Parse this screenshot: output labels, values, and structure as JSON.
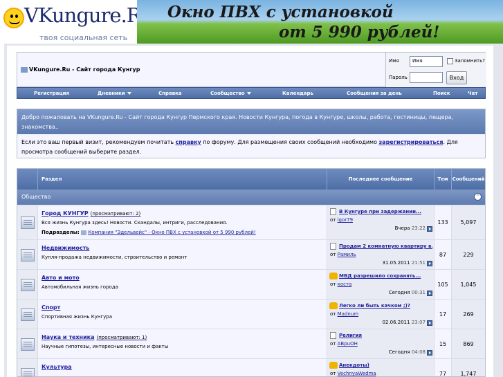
{
  "logo": {
    "brand": "VKungure.Ru",
    "tagline": "твоя социальная сеть"
  },
  "banner": {
    "line1": "Окно ПВХ с установкой",
    "line2": "от 5 990 рублей!"
  },
  "site": {
    "title": "VKungure.Ru - Сайт города Кунгур"
  },
  "login": {
    "username_label": "Имя",
    "username_value": "Имя",
    "remember_label": "Запомнить?",
    "password_label": "Пароль",
    "submit_label": "Вход"
  },
  "nav": {
    "items": [
      "Регистрация",
      "Дневники",
      "Справка",
      "Сообщество",
      "Календарь",
      "Сообщения за день",
      "Поиск",
      "Чат"
    ]
  },
  "welcome": {
    "title": "Добро пожаловать на VKungure.Ru - Сайт города Кунгур Пермского края. Новости Кунгура, погода в Кунгуре, школы, работа, гостиницы, пещера, знакомства..",
    "text_a": "Если это ваш первый визит, рекомендуем почитать ",
    "link_help": "справку",
    "text_b": " по форуму. Для размещения своих сообщений необходимо ",
    "link_register": "зарегистрироваться",
    "text_c": ". Для просмотра сообщений выберите раздел."
  },
  "table": {
    "headers": {
      "section": "Раздел",
      "last_post": "Последнее сообщение",
      "threads": "Тем",
      "posts": "Сообщений"
    },
    "category": "Общество",
    "subforums_label": "Подразделы:",
    "by_prefix": "от",
    "rows": [
      {
        "name": "Город КУНГУР",
        "viewing": "(просматривают: 2)",
        "desc": "Вся жизнь Кунгура здесь! Новости. Скандалы, интриги, расследования.",
        "subforum": "Компания \"Эдельвейс\" - Окно ПВХ с установкой от 5 990 рублей!",
        "last_title": "В Кунгуре при задержании...",
        "last_by": "igor79",
        "last_date": "Вчера",
        "last_time": "23:22",
        "icon": "post",
        "threads": "133",
        "posts": "5,097"
      },
      {
        "name": "Недвижимость",
        "viewing": "",
        "desc": "Купля-продажа недвижимости, строительство и ремонт",
        "subforum": "",
        "last_title": "Продам 2 комнатную квартиру в...",
        "last_by": "Рамиль",
        "last_date": "31.05.2011",
        "last_time": "21:51",
        "icon": "post",
        "threads": "87",
        "posts": "229"
      },
      {
        "name": "Авто и мото",
        "viewing": "",
        "desc": "Автомобильная жизнь города",
        "subforum": "",
        "last_title": "МВД разрешило сохранять...",
        "last_by": "коста",
        "last_date": "Сегодня",
        "last_time": "00:31",
        "icon": "thumb",
        "threads": "105",
        "posts": "1,045"
      },
      {
        "name": "Спорт",
        "viewing": "",
        "desc": "Спортивная жизнь Кунгура",
        "subforum": "",
        "last_title": "Легко ли быть качком ;)?",
        "last_by": "Madnum",
        "last_date": "02.06.2011",
        "last_time": "23:07",
        "icon": "thumb",
        "threads": "17",
        "posts": "269"
      },
      {
        "name": "Наука и техника",
        "viewing": "(просматривают: 1)",
        "desc": "Научные гипотезы, интересные новости и факты",
        "subforum": "",
        "last_title": "Религия",
        "last_by": "ABpuOH",
        "last_date": "Сегодня",
        "last_time": "04:08",
        "icon": "post",
        "threads": "15",
        "posts": "869"
      },
      {
        "name": "Культура",
        "viewing": "",
        "desc": "",
        "subforum": "",
        "last_title": "Анекдоты)",
        "last_by": "VechnyaWedma",
        "last_date": "",
        "last_time": "",
        "icon": "thumb",
        "threads": "77",
        "posts": "1,747"
      }
    ]
  }
}
